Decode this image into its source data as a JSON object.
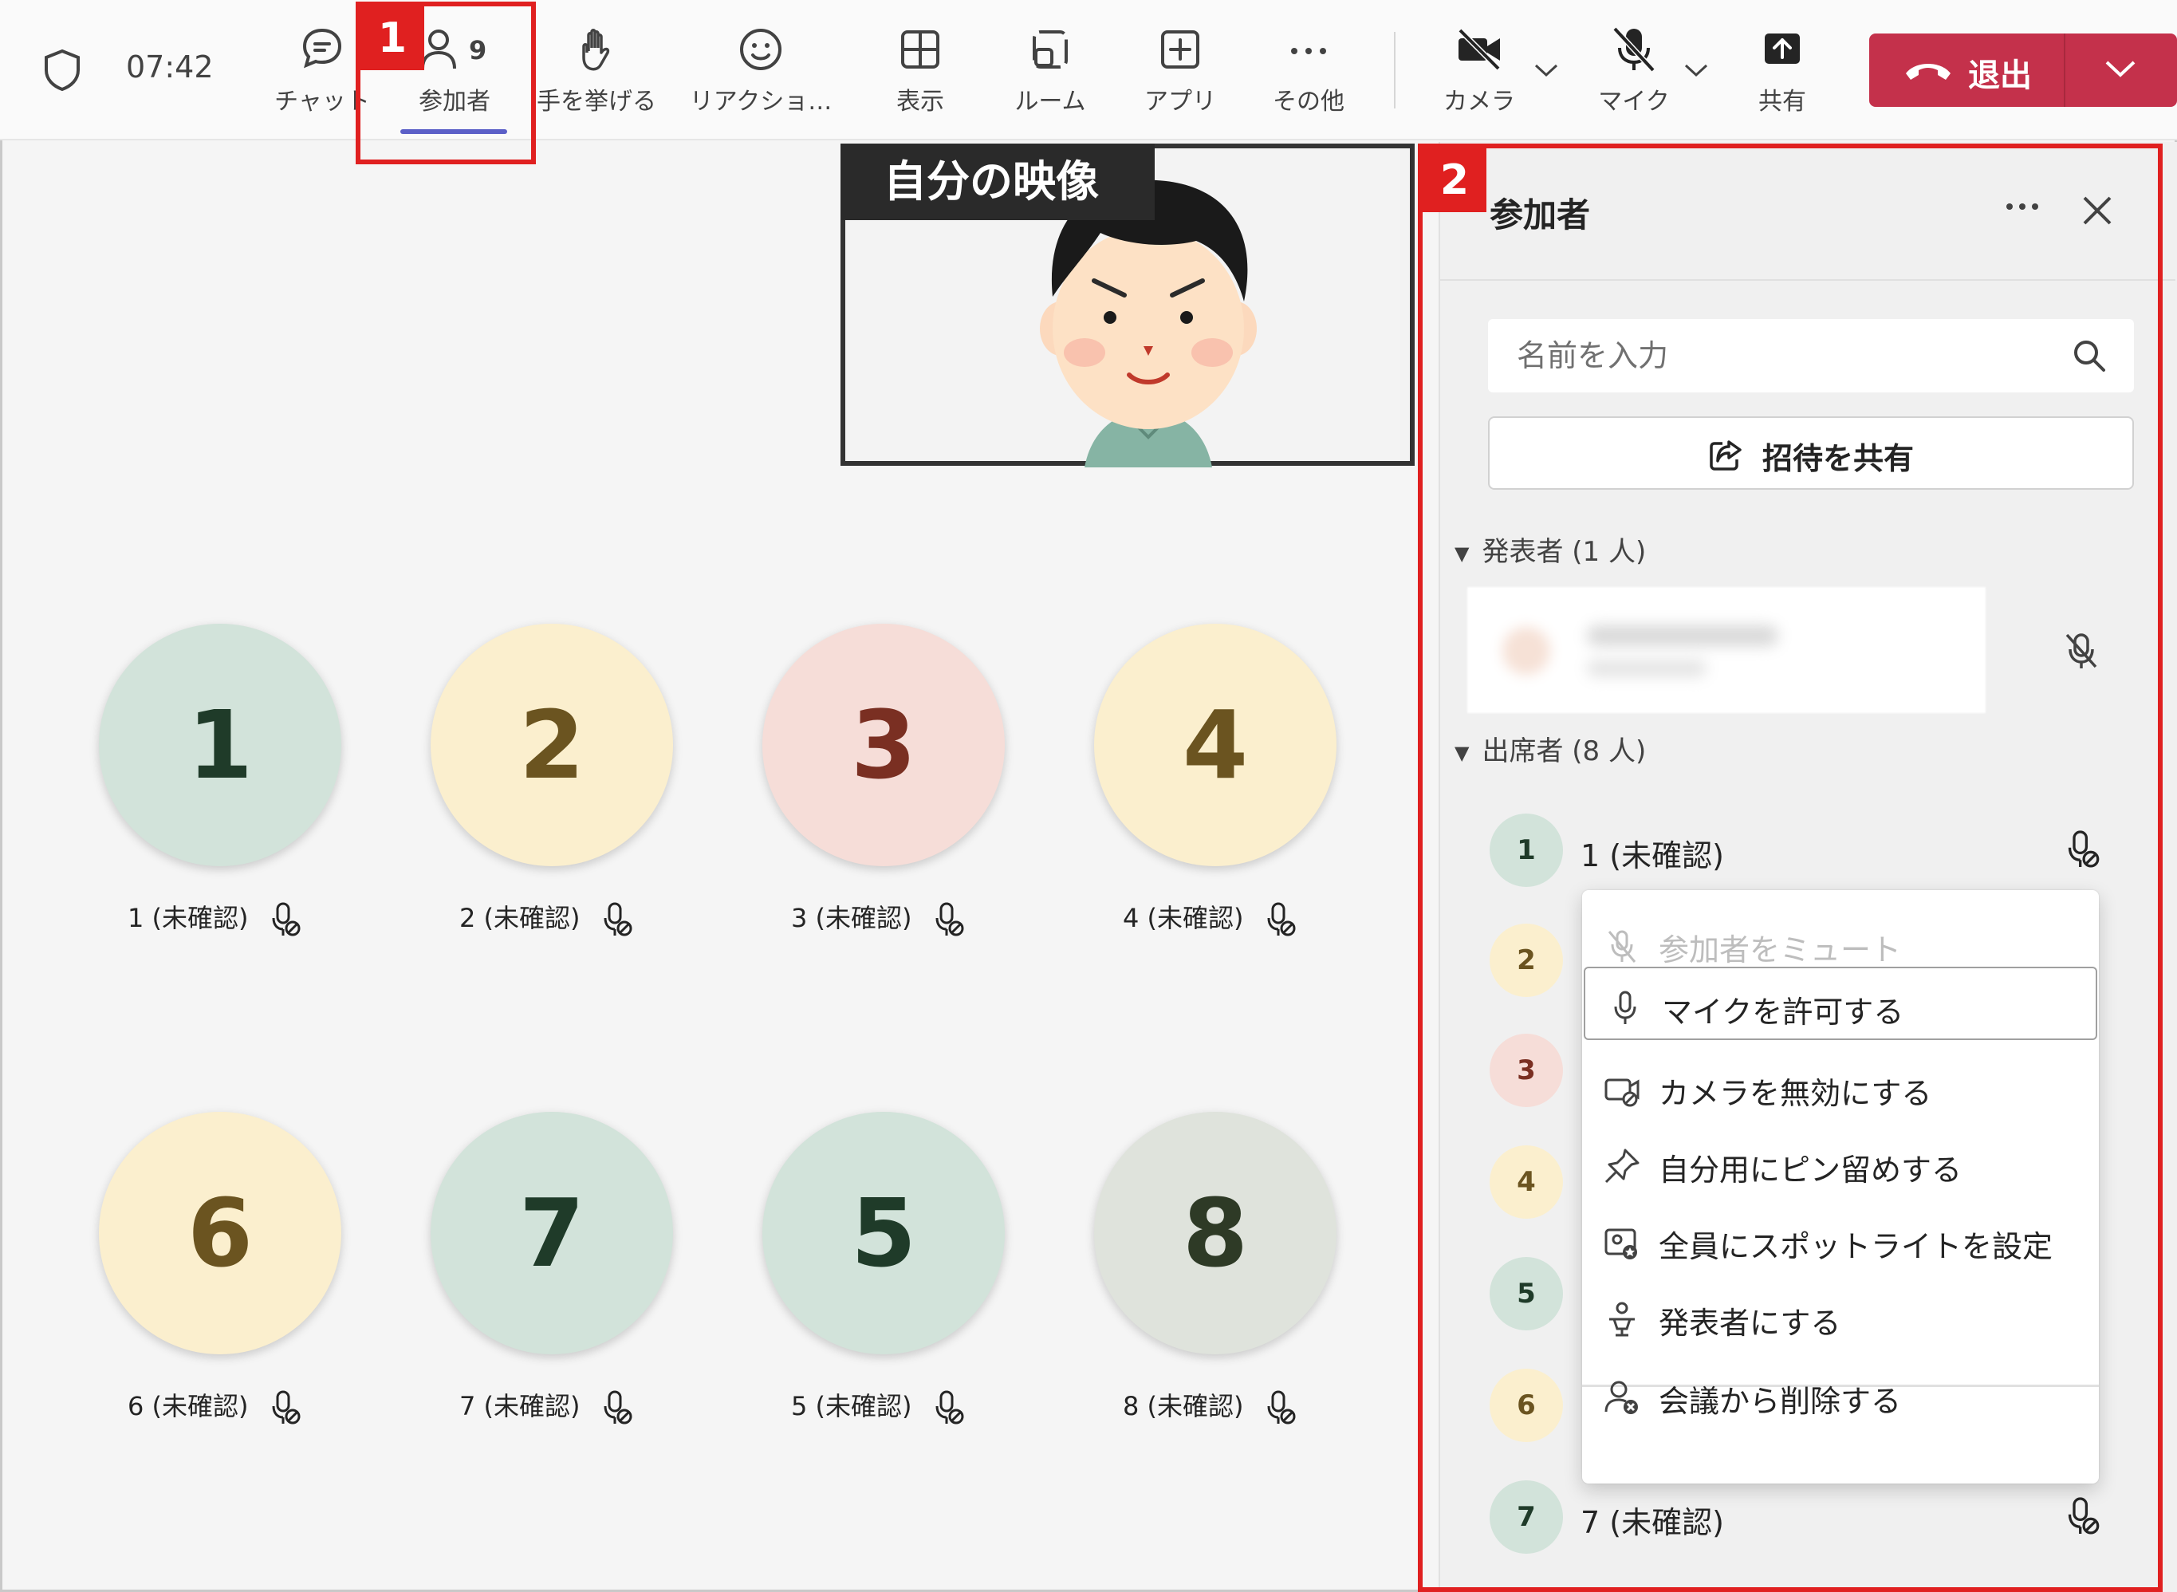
{
  "topbar": {
    "time": "07:42",
    "participant_count": "9",
    "buttons": {
      "chat": "チャット",
      "people": "参加者",
      "raise_hand": "手を挙げる",
      "react": "リアクショ…",
      "view": "表示",
      "rooms": "ルーム",
      "apps": "アプリ",
      "more": "その他",
      "camera": "カメラ",
      "mic": "マイク",
      "share": "共有"
    },
    "leave_label": "退出"
  },
  "annotations": {
    "step1": "1",
    "step2": "2"
  },
  "self_video": {
    "label": "自分の映像"
  },
  "tiles": [
    {
      "number": "1",
      "label": "1 (未確認)",
      "color": "#d2e3da",
      "text_color": "#1f3b29"
    },
    {
      "number": "2",
      "label": "2 (未確認)",
      "color": "#fbefce",
      "text_color": "#6b5420"
    },
    {
      "number": "3",
      "label": "3 (未確認)",
      "color": "#f6ddd8",
      "text_color": "#7a2f22"
    },
    {
      "number": "4",
      "label": "4 (未確認)",
      "color": "#fbefce",
      "text_color": "#6b5420"
    },
    {
      "number": "6",
      "label": "6 (未確認)",
      "color": "#fbefce",
      "text_color": "#6b5420"
    },
    {
      "number": "7",
      "label": "7 (未確認)",
      "color": "#d2e3da",
      "text_color": "#1f3b29"
    },
    {
      "number": "5",
      "label": "5 (未確認)",
      "color": "#d2e3da",
      "text_color": "#1f3b29"
    },
    {
      "number": "8",
      "label": "8 (未確認)",
      "color": "#dfe3dc",
      "text_color": "#2e3a26"
    }
  ],
  "panel": {
    "title": "参加者",
    "search_placeholder": "名前を入力",
    "invite_label": "招待を共有",
    "presenters_header": "発表者 (1 人)",
    "attendees_header": "出席者 (8 人)",
    "attendees": [
      {
        "number": "1",
        "name": "1 (未確認)",
        "color": "#d2e3da",
        "text_color": "#1f3b29"
      },
      {
        "number": "2",
        "name": "",
        "color": "#fbefce",
        "text_color": "#6b5420"
      },
      {
        "number": "3",
        "name": "",
        "color": "#f6ddd8",
        "text_color": "#7a2f22"
      },
      {
        "number": "4",
        "name": "",
        "color": "#fbefce",
        "text_color": "#6b5420"
      },
      {
        "number": "5",
        "name": "",
        "color": "#d2e3da",
        "text_color": "#1f3b29"
      },
      {
        "number": "6",
        "name": "",
        "color": "#fbefce",
        "text_color": "#6b5420"
      },
      {
        "number": "7",
        "name": "7 (未確認)",
        "color": "#d2e3da",
        "text_color": "#1f3b29"
      }
    ]
  },
  "context_menu": {
    "items": [
      {
        "label": "参加者をミュート",
        "icon": "mic-off-icon",
        "disabled": true
      },
      {
        "label": "マイクを許可する",
        "icon": "mic-icon",
        "focused": true
      },
      {
        "label": "カメラを無効にする",
        "icon": "camera-off-icon"
      },
      {
        "label": "自分用にピン留めする",
        "icon": "pin-icon"
      },
      {
        "label": "全員にスポットライトを設定",
        "icon": "spotlight-icon"
      },
      {
        "label": "発表者にする",
        "icon": "presenter-icon"
      },
      {
        "label": "会議から削除する",
        "icon": "remove-person-icon"
      }
    ]
  },
  "colors": {
    "accent": "#5b5fc7",
    "leave": "#c4314b",
    "annotation": "#e02020"
  }
}
